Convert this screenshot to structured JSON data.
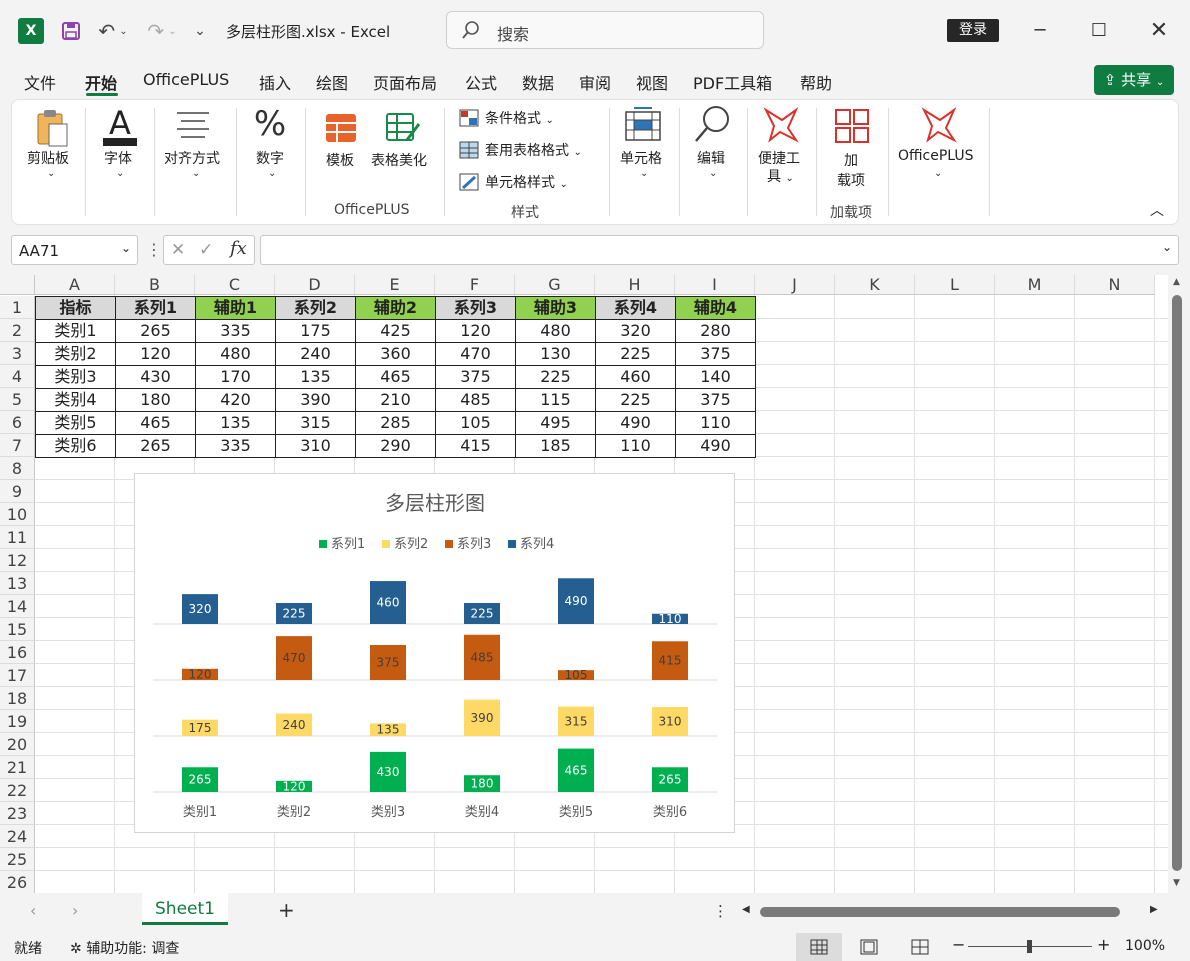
{
  "titlebar": {
    "filename": "多层柱形图.xlsx",
    "app": "Excel",
    "search_placeholder": "搜索",
    "login": "登录"
  },
  "menu": [
    "文件",
    "开始",
    "OfficePLUS",
    "插入",
    "绘图",
    "页面布局",
    "公式",
    "数据",
    "审阅",
    "视图",
    "PDF工具箱",
    "帮助"
  ],
  "share": "共享",
  "ribbon": {
    "clipboard": "剪贴板",
    "font": "字体",
    "align": "对齐方式",
    "number": "数字",
    "template": "模板",
    "beautify": "表格美化",
    "group_officeplus": "OfficePLUS",
    "cond_format": "条件格式",
    "table_format": "套用表格格式",
    "cell_style": "单元格样式",
    "group_style": "样式",
    "cells": "单元格",
    "edit": "编辑",
    "quicktools": "便捷工",
    "quicktools2": "具",
    "addin1": "加",
    "addin2": "载项",
    "group_addin": "加载项",
    "officeplus_btn": "OfficePLUS"
  },
  "formula": {
    "namebox": "AA71",
    "content": ""
  },
  "columns": [
    "A",
    "B",
    "C",
    "D",
    "E",
    "F",
    "G",
    "H",
    "I",
    "J",
    "K",
    "L",
    "M",
    "N"
  ],
  "rows": [
    "1",
    "2",
    "3",
    "4",
    "5",
    "6",
    "7",
    "8",
    "9",
    "10",
    "11",
    "12",
    "13",
    "14",
    "15",
    "16",
    "17",
    "18",
    "19",
    "20",
    "21",
    "22",
    "23",
    "24",
    "25",
    "26"
  ],
  "table": {
    "headers": [
      "指标",
      "系列1",
      "辅助1",
      "系列2",
      "辅助2",
      "系列3",
      "辅助3",
      "系列4",
      "辅助4"
    ],
    "rows": [
      [
        "类别1",
        "265",
        "335",
        "175",
        "425",
        "120",
        "480",
        "320",
        "280"
      ],
      [
        "类别2",
        "120",
        "480",
        "240",
        "360",
        "470",
        "130",
        "225",
        "375"
      ],
      [
        "类别3",
        "430",
        "170",
        "135",
        "465",
        "375",
        "225",
        "460",
        "140"
      ],
      [
        "类别4",
        "180",
        "420",
        "390",
        "210",
        "485",
        "115",
        "225",
        "375"
      ],
      [
        "类别5",
        "465",
        "135",
        "315",
        "285",
        "105",
        "495",
        "490",
        "110"
      ],
      [
        "类别6",
        "265",
        "335",
        "310",
        "290",
        "415",
        "185",
        "110",
        "490"
      ]
    ]
  },
  "chart_data": {
    "type": "bar",
    "title": "多层柱形图",
    "categories": [
      "类别1",
      "类别2",
      "类别3",
      "类别4",
      "类别5",
      "类别6"
    ],
    "series": [
      {
        "name": "系列1",
        "color": "#00b050",
        "values": [
          265,
          120,
          430,
          180,
          465,
          265
        ]
      },
      {
        "name": "系列2",
        "color": "#ffd966",
        "values": [
          175,
          240,
          135,
          390,
          315,
          310
        ]
      },
      {
        "name": "系列3",
        "color": "#c55a11",
        "values": [
          120,
          470,
          375,
          485,
          105,
          415
        ]
      },
      {
        "name": "系列4",
        "color": "#255e91",
        "values": [
          320,
          225,
          460,
          225,
          490,
          110
        ]
      }
    ],
    "layer_max": 600,
    "legend": "top",
    "stacked_layers": true
  },
  "sheet": {
    "name": "Sheet1"
  },
  "status": {
    "ready": "就绪",
    "accessibility": "辅助功能: 调查",
    "zoom": "100%"
  }
}
